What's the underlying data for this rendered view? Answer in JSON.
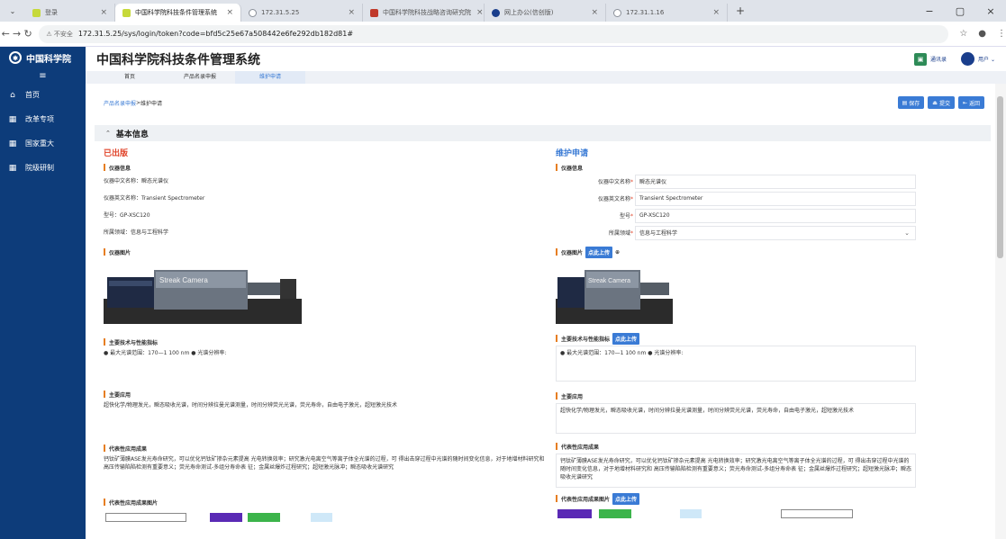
{
  "browser": {
    "tabs": [
      {
        "label": "登录",
        "color": "#c6d93a"
      },
      {
        "label": "中国科学院科技条件管理系统",
        "color": "#c6d93a",
        "active": true
      },
      {
        "label": "172.31.5.25",
        "color": "#8a8f98"
      },
      {
        "label": "中国科学院科技战略咨询研究院",
        "color": "#c0392b"
      },
      {
        "label": "网上办公(信创版)",
        "color": "#1a3e8c"
      },
      {
        "label": "172.31.1.16",
        "color": "#8a8f98"
      }
    ],
    "new_tab": "+",
    "address_warning": "不安全",
    "url": "172.31.5.25/sys/login/token?code=bfd5c25e67a508442e6fe292db182d81#"
  },
  "sidebar": {
    "logo_text": "中国科学院",
    "menu_icon": "≡",
    "items": [
      {
        "label": "首页",
        "icon": "home-icon"
      },
      {
        "label": "改革专项",
        "icon": "grid-icon"
      },
      {
        "label": "国家重大",
        "icon": "grid-icon"
      },
      {
        "label": "院级研制",
        "icon": "grid-icon"
      }
    ]
  },
  "header": {
    "title": "中国科学院科技条件管理系统",
    "contacts_label": "通讯录",
    "user_label": "用户"
  },
  "topnav": {
    "tabs": [
      "首页",
      "产品名录申报",
      "维护申请"
    ]
  },
  "content": {
    "breadcrumb_link": "产品名录申报",
    "breadcrumb_sep": ">",
    "breadcrumb_current": "维护申请",
    "actions": {
      "save": "保存",
      "submit": "提交",
      "back": "返回"
    },
    "section_title": "基本信息",
    "left": {
      "title": "已出版",
      "instrument_info": "仪器信息",
      "cn_name": "仪器中文名称：瞬态光谱仪",
      "en_name": "仪器英文名称：Transient Spectrometer",
      "model": "型号：GP-XSC120",
      "field": "所属领域：信息与工程科学",
      "image_heading": "仪器图片",
      "camera_label": "Streak Camera",
      "tech_heading": "主要技术与性能指标",
      "tech_text": "● 最大光谱范围：170—1 100 nm ● 光谱分辨率:",
      "app_heading": "主要应用",
      "app_text": "超快化学/物理发光，瞬态吸收光谱，时间分辨拉曼光谱测量，时间分辨荧光光谱，荧光寿命，自由电子激光，超短激光技术",
      "result_heading": "代表性应用成果",
      "result_text": "钙钛矿薄膜ASE发光寿命研究，可以优化钙钛矿掺杂元素提高 光电转换效率；研究激光电离空气等离子体全光谱的过程，可 得出击穿过程中光谱的随时间变化信息，对于地增材料研究和 高压传输陷陷检测有重要意义；荧光寿命测试-多组分寿命表 征；金属丝爆炸过程研究；超短激光脉冲；瞬态吸收光谱研究",
      "result_img_heading": "代表性应用成果图片"
    },
    "right": {
      "title": "维护申请",
      "instrument_info": "仪器信息",
      "cn_name_label": "仪器中文名称",
      "cn_name_value": "瞬态光谱仪",
      "en_name_label": "仪器英文名称",
      "en_name_value": "Transient Spectrometer",
      "model_label": "型号",
      "model_value": "GP-XSC120",
      "field_label": "所属领域",
      "field_value": "信息与工程科学",
      "required_mark": "*",
      "image_heading": "仪器图片",
      "upload_label": "点此上传",
      "camera_label": "Streak Camera",
      "tech_heading": "主要技术与性能指标",
      "tech_text": "● 最大光谱范围：170—1 100 nm ● 光谱分辨率:",
      "app_heading": "主要应用",
      "app_text": "超快化学/物理发光，瞬态吸收光谱，时间分辨拉曼光谱测量，时间分辨荧光光谱，荧光寿命，自由电子激光，超短激光技术",
      "result_heading": "代表性应用成果",
      "result_text": "钙钛矿薄膜ASE发光寿命研究，可以优化钙钛矿掺杂元素提高 光电转换效率；研究激光电离空气等离子体全光谱的过程，可 得出击穿过程中光谱的随时间变化信息，对于地增材料研究和 高压传输陷陷检测有重要意义；荧光寿命测试-多组分寿命表 征；金属丝爆炸过程研究；超短激光脉冲；瞬态吸收光谱研究",
      "result_img_heading": "代表性应用成果图片"
    }
  },
  "colors": {
    "sidebar": "#0d3c7a",
    "accent": "#3a7bd5",
    "published": "#e0442a",
    "subbar": "#e67e22"
  }
}
